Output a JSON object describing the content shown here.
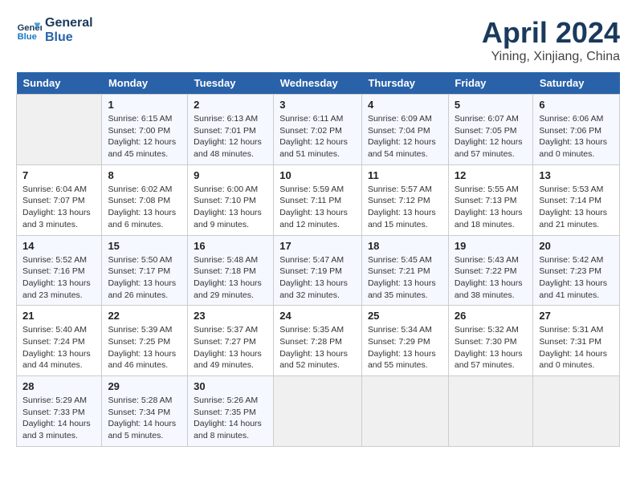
{
  "header": {
    "logo_line1": "General",
    "logo_line2": "Blue",
    "title": "April 2024",
    "subtitle": "Yining, Xinjiang, China"
  },
  "days_of_week": [
    "Sunday",
    "Monday",
    "Tuesday",
    "Wednesday",
    "Thursday",
    "Friday",
    "Saturday"
  ],
  "weeks": [
    [
      {
        "num": "",
        "info": ""
      },
      {
        "num": "1",
        "info": "Sunrise: 6:15 AM\nSunset: 7:00 PM\nDaylight: 12 hours\nand 45 minutes."
      },
      {
        "num": "2",
        "info": "Sunrise: 6:13 AM\nSunset: 7:01 PM\nDaylight: 12 hours\nand 48 minutes."
      },
      {
        "num": "3",
        "info": "Sunrise: 6:11 AM\nSunset: 7:02 PM\nDaylight: 12 hours\nand 51 minutes."
      },
      {
        "num": "4",
        "info": "Sunrise: 6:09 AM\nSunset: 7:04 PM\nDaylight: 12 hours\nand 54 minutes."
      },
      {
        "num": "5",
        "info": "Sunrise: 6:07 AM\nSunset: 7:05 PM\nDaylight: 12 hours\nand 57 minutes."
      },
      {
        "num": "6",
        "info": "Sunrise: 6:06 AM\nSunset: 7:06 PM\nDaylight: 13 hours\nand 0 minutes."
      }
    ],
    [
      {
        "num": "7",
        "info": "Sunrise: 6:04 AM\nSunset: 7:07 PM\nDaylight: 13 hours\nand 3 minutes."
      },
      {
        "num": "8",
        "info": "Sunrise: 6:02 AM\nSunset: 7:08 PM\nDaylight: 13 hours\nand 6 minutes."
      },
      {
        "num": "9",
        "info": "Sunrise: 6:00 AM\nSunset: 7:10 PM\nDaylight: 13 hours\nand 9 minutes."
      },
      {
        "num": "10",
        "info": "Sunrise: 5:59 AM\nSunset: 7:11 PM\nDaylight: 13 hours\nand 12 minutes."
      },
      {
        "num": "11",
        "info": "Sunrise: 5:57 AM\nSunset: 7:12 PM\nDaylight: 13 hours\nand 15 minutes."
      },
      {
        "num": "12",
        "info": "Sunrise: 5:55 AM\nSunset: 7:13 PM\nDaylight: 13 hours\nand 18 minutes."
      },
      {
        "num": "13",
        "info": "Sunrise: 5:53 AM\nSunset: 7:14 PM\nDaylight: 13 hours\nand 21 minutes."
      }
    ],
    [
      {
        "num": "14",
        "info": "Sunrise: 5:52 AM\nSunset: 7:16 PM\nDaylight: 13 hours\nand 23 minutes."
      },
      {
        "num": "15",
        "info": "Sunrise: 5:50 AM\nSunset: 7:17 PM\nDaylight: 13 hours\nand 26 minutes."
      },
      {
        "num": "16",
        "info": "Sunrise: 5:48 AM\nSunset: 7:18 PM\nDaylight: 13 hours\nand 29 minutes."
      },
      {
        "num": "17",
        "info": "Sunrise: 5:47 AM\nSunset: 7:19 PM\nDaylight: 13 hours\nand 32 minutes."
      },
      {
        "num": "18",
        "info": "Sunrise: 5:45 AM\nSunset: 7:21 PM\nDaylight: 13 hours\nand 35 minutes."
      },
      {
        "num": "19",
        "info": "Sunrise: 5:43 AM\nSunset: 7:22 PM\nDaylight: 13 hours\nand 38 minutes."
      },
      {
        "num": "20",
        "info": "Sunrise: 5:42 AM\nSunset: 7:23 PM\nDaylight: 13 hours\nand 41 minutes."
      }
    ],
    [
      {
        "num": "21",
        "info": "Sunrise: 5:40 AM\nSunset: 7:24 PM\nDaylight: 13 hours\nand 44 minutes."
      },
      {
        "num": "22",
        "info": "Sunrise: 5:39 AM\nSunset: 7:25 PM\nDaylight: 13 hours\nand 46 minutes."
      },
      {
        "num": "23",
        "info": "Sunrise: 5:37 AM\nSunset: 7:27 PM\nDaylight: 13 hours\nand 49 minutes."
      },
      {
        "num": "24",
        "info": "Sunrise: 5:35 AM\nSunset: 7:28 PM\nDaylight: 13 hours\nand 52 minutes."
      },
      {
        "num": "25",
        "info": "Sunrise: 5:34 AM\nSunset: 7:29 PM\nDaylight: 13 hours\nand 55 minutes."
      },
      {
        "num": "26",
        "info": "Sunrise: 5:32 AM\nSunset: 7:30 PM\nDaylight: 13 hours\nand 57 minutes."
      },
      {
        "num": "27",
        "info": "Sunrise: 5:31 AM\nSunset: 7:31 PM\nDaylight: 14 hours\nand 0 minutes."
      }
    ],
    [
      {
        "num": "28",
        "info": "Sunrise: 5:29 AM\nSunset: 7:33 PM\nDaylight: 14 hours\nand 3 minutes."
      },
      {
        "num": "29",
        "info": "Sunrise: 5:28 AM\nSunset: 7:34 PM\nDaylight: 14 hours\nand 5 minutes."
      },
      {
        "num": "30",
        "info": "Sunrise: 5:26 AM\nSunset: 7:35 PM\nDaylight: 14 hours\nand 8 minutes."
      },
      {
        "num": "",
        "info": ""
      },
      {
        "num": "",
        "info": ""
      },
      {
        "num": "",
        "info": ""
      },
      {
        "num": "",
        "info": ""
      }
    ]
  ]
}
